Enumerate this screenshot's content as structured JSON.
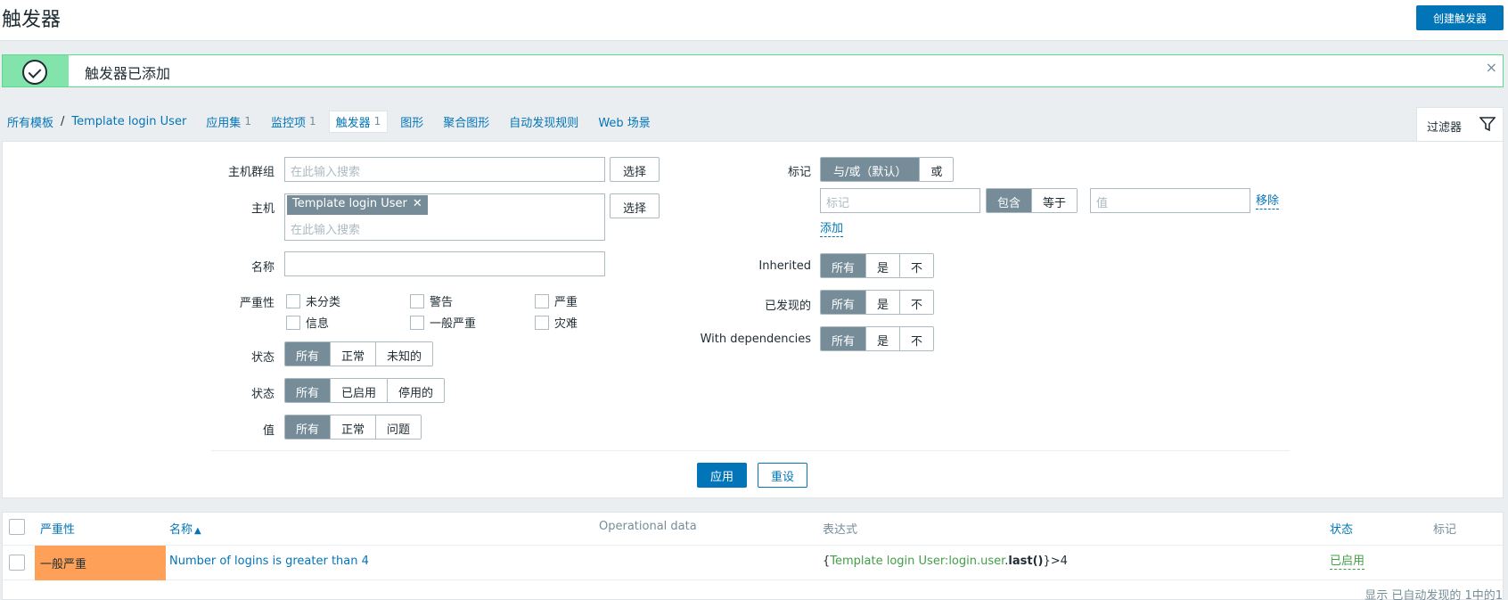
{
  "header": {
    "title": "触发器",
    "create_button": "创建触发器"
  },
  "message": {
    "text": "触发器已添加",
    "close": "×"
  },
  "breadcrumb": {
    "all_templates": "所有模板",
    "separator": "/",
    "template_name": "Template login User",
    "tabs": [
      {
        "label": "应用集",
        "count": "1"
      },
      {
        "label": "监控项",
        "count": "1"
      },
      {
        "label": "触发器",
        "count": "1"
      },
      {
        "label": "图形",
        "count": ""
      },
      {
        "label": "聚合图形",
        "count": ""
      },
      {
        "label": "自动发现规则",
        "count": ""
      },
      {
        "label": "Web 场景",
        "count": ""
      }
    ]
  },
  "filter_tab": {
    "label": "过滤器"
  },
  "filter": {
    "host_group": {
      "label": "主机群组",
      "placeholder": "在此输入搜索",
      "select": "选择"
    },
    "host": {
      "label": "主机",
      "chip": "Template login User",
      "chip_remove": "✕",
      "placeholder": "在此输入搜索",
      "select": "选择"
    },
    "name": {
      "label": "名称",
      "value": ""
    },
    "severity": {
      "label": "严重性",
      "options": [
        "未分类",
        "警告",
        "严重",
        "信息",
        "一般严重",
        "灾难"
      ]
    },
    "state": {
      "label": "状态",
      "options": [
        "所有",
        "正常",
        "未知的"
      ],
      "selected": "所有"
    },
    "status": {
      "label": "状态",
      "options": [
        "所有",
        "已启用",
        "停用的"
      ],
      "selected": "所有"
    },
    "value": {
      "label": "值",
      "options": [
        "所有",
        "正常",
        "问题"
      ],
      "selected": "所有"
    },
    "tags": {
      "label": "标记",
      "operator_options": [
        "与/或（默认）",
        "或"
      ],
      "operator_selected": "与/或（默认）",
      "tag_placeholder": "标记",
      "match_options": [
        "包含",
        "等于"
      ],
      "match_selected": "包含",
      "value_placeholder": "值",
      "remove": "移除",
      "add": "添加"
    },
    "inherited": {
      "label": "Inherited",
      "options": [
        "所有",
        "是",
        "不"
      ],
      "selected": "所有"
    },
    "discovered": {
      "label": "已发现的",
      "options": [
        "所有",
        "是",
        "不"
      ],
      "selected": "所有"
    },
    "with_dependencies": {
      "label": "With dependencies",
      "options": [
        "所有",
        "是",
        "不"
      ],
      "selected": "所有"
    },
    "apply": "应用",
    "reset": "重设"
  },
  "table": {
    "columns": {
      "severity": "严重性",
      "name": "名称",
      "sort_arrow": "▲",
      "operational_data": "Operational data",
      "expression": "表达式",
      "status": "状态",
      "tags": "标记"
    },
    "rows": [
      {
        "severity": "一般严重",
        "name": "Number of logins is greater than 4",
        "expr_open": "{",
        "expr_host_key": "Template login User:login.user",
        "expr_dot": ".",
        "expr_func": "last()",
        "expr_close": "}>4",
        "status": "已启用",
        "severity_color": "#ffa059"
      }
    ],
    "footer": "显示 已自动发现的 1中的1"
  }
}
